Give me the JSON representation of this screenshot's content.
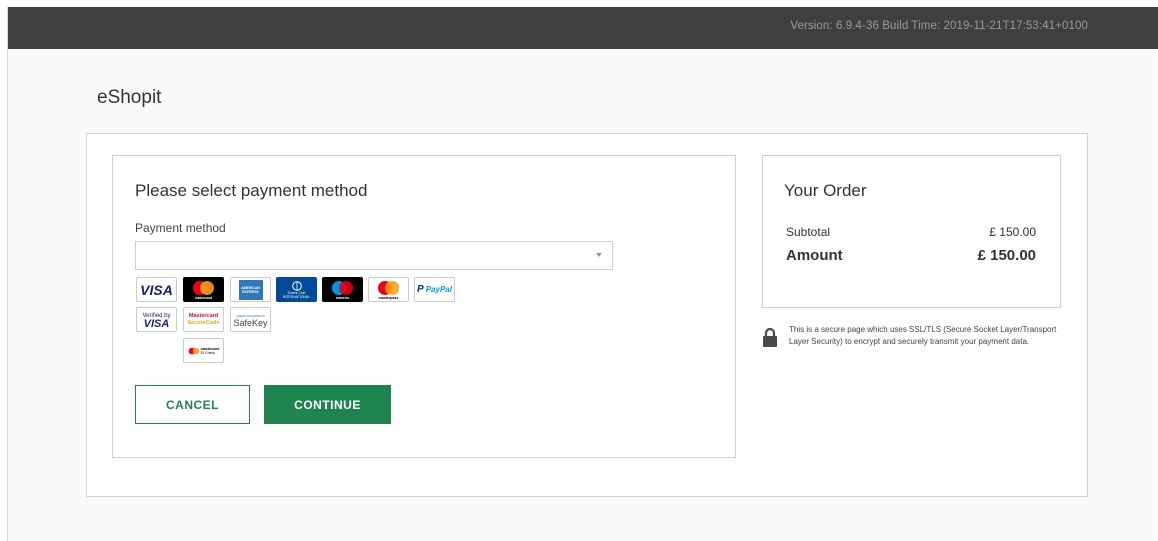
{
  "header": {
    "version_text": "Version: 6.9.4-36 Build Time: 2019-11-21T17:53:41+0100"
  },
  "brand": {
    "name": "eShopit"
  },
  "payment": {
    "title": "Please select payment method",
    "method_label": "Payment method",
    "selected_value": "",
    "logos": [
      {
        "name": "visa",
        "label": "VISA",
        "color": "#1a1f71"
      },
      {
        "name": "mastercard",
        "label": "mastercard",
        "color": "#000000"
      },
      {
        "name": "american-express",
        "label": "AMERICAN EXPRESS",
        "color": "#2e77bc"
      },
      {
        "name": "diners-club",
        "label": "Diners Club INTERNATIONAL",
        "color": "#004a97"
      },
      {
        "name": "maestro",
        "label": "maestro",
        "color": "#000000"
      },
      {
        "name": "masterpass",
        "label": "masterpass",
        "color": "#ffffff"
      },
      {
        "name": "paypal",
        "label": "PayPal",
        "color": "#003087"
      },
      {
        "name": "verified-by-visa",
        "label_top": "Verified by",
        "label_bottom": "VISA"
      },
      {
        "name": "mastercard-securecode",
        "label_top": "Mastercard",
        "label_bottom": "SecureCode"
      },
      {
        "name": "amex-safekey",
        "label_top": "AMERICAN EXPRESS",
        "label_bottom": "SafeKey"
      },
      {
        "name": "mastercard-id-check",
        "label_top": "mastercard",
        "label_bottom": "ID Check"
      }
    ],
    "cancel_label": "CANCEL",
    "continue_label": "CONTINUE"
  },
  "order": {
    "title": "Your Order",
    "subtotal_label": "Subtotal",
    "subtotal_value": "£ 150.00",
    "amount_label": "Amount",
    "amount_value": "£ 150.00"
  },
  "security": {
    "text": "This is a secure page which uses SSL/TLS (Secure Socket Layer/Transport Layer Security) to encrypt and securely transmit your payment data."
  },
  "colors": {
    "accent_green": "#1f8450",
    "topbar": "#3f3f3f"
  }
}
